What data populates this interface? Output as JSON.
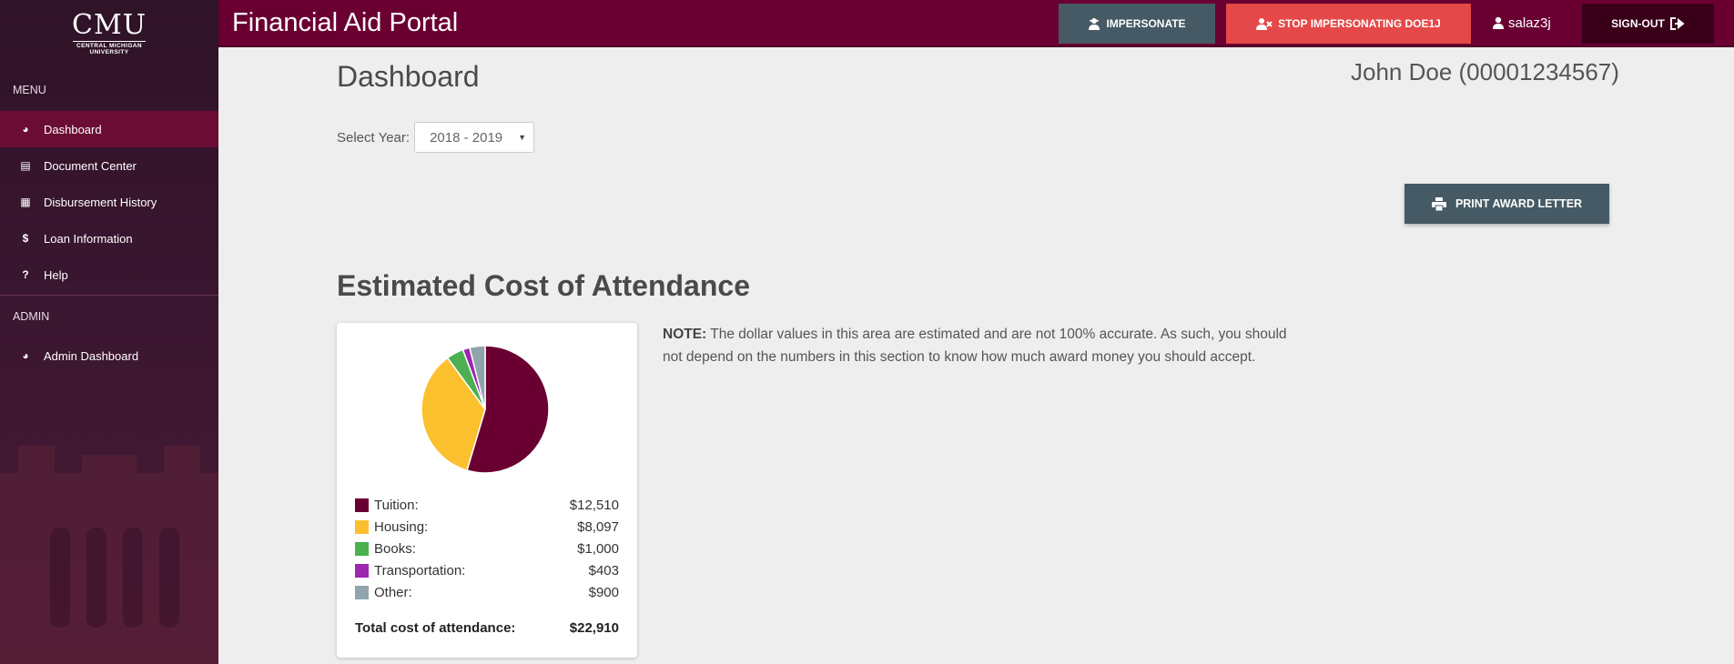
{
  "app": {
    "title": "Financial Aid Portal",
    "colors": {
      "brand": "#6a0032",
      "slate": "#455a64",
      "danger": "#e54848"
    }
  },
  "logo": {
    "wordmark": "CMU",
    "line1": "CENTRAL MICHIGAN",
    "line2": "UNIVERSITY"
  },
  "sidebar": {
    "menu_header": "MENU",
    "items": [
      {
        "label": "Dashboard",
        "icon": "dashboard-icon",
        "glyph": "◕",
        "active": true
      },
      {
        "label": "Document Center",
        "icon": "archive-icon",
        "glyph": "▤",
        "active": false
      },
      {
        "label": "Disbursement History",
        "icon": "calendar-icon",
        "glyph": "▦",
        "active": false
      },
      {
        "label": "Loan Information",
        "icon": "dollar-icon",
        "glyph": "$",
        "active": false
      },
      {
        "label": "Help",
        "icon": "question-icon",
        "glyph": "?",
        "active": false
      }
    ],
    "admin_header": "ADMIN",
    "admin_items": [
      {
        "label": "Admin Dashboard",
        "icon": "dashboard-icon",
        "glyph": "◕"
      }
    ]
  },
  "topbar": {
    "impersonate_label": "IMPERSONATE",
    "stop_label": "STOP IMPERSONATING DOE1J",
    "username": "salaz3j",
    "signout_label": "SIGN-OUT"
  },
  "main": {
    "page_title": "Dashboard",
    "student": "John Doe (00001234567)",
    "year_label": "Select Year:",
    "year_value": "2018 - 2019",
    "print_label": "PRINT AWARD LETTER",
    "section_title": "Estimated Cost of Attendance",
    "note_label": "NOTE:",
    "note_text": " The dollar values in this area are estimated and are not 100% accurate. As such, you should not depend on the numbers in this section to know how much award money you should accept.",
    "total_label": "Total cost of attendance:",
    "total_value": "$22,910"
  },
  "chart_data": {
    "type": "pie",
    "categories": [
      "Tuition:",
      "Housing:",
      "Books:",
      "Transportation:",
      "Other:"
    ],
    "values": [
      12510,
      8097,
      1000,
      403,
      900
    ],
    "display_values": [
      "$12,510",
      "$8,097",
      "$1,000",
      "$403",
      "$900"
    ],
    "colors": [
      "#6a0032",
      "#fbc02d",
      "#4caf50",
      "#9c27b0",
      "#90a4ae"
    ],
    "legend_position": "bottom"
  }
}
